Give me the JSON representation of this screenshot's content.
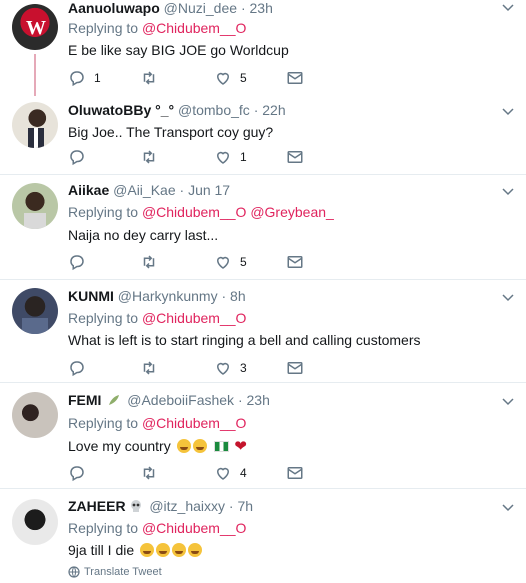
{
  "tweets": [
    {
      "name": "Aanuoluwapo",
      "handle": "@Nuzi_dee",
      "dot": "·",
      "time": "23h",
      "replying": "Replying to",
      "mention1": "@Chidubem__O",
      "mention2": "",
      "text": "E be like say BIG JOE go Worldcup",
      "replies": "1",
      "retweets": "",
      "likes": "5"
    },
    {
      "name": "OluwatoBBy °_°",
      "handle": "@tombo_fc",
      "dot": "·",
      "time": "22h",
      "text": "Big Joe.. The Transport coy guy?",
      "replies": "",
      "retweets": "",
      "likes": "1"
    },
    {
      "name": "Aiikae",
      "handle": "@Aii_Kae",
      "dot": "·",
      "time": "Jun 17",
      "replying": "Replying to",
      "mention1": "@Chidubem__O",
      "mention2": "@Greybean_",
      "text": "Naija no dey carry last...",
      "replies": "",
      "retweets": "",
      "likes": "5"
    },
    {
      "name": "KUNMI",
      "handle": "@Harkynkunmy",
      "dot": "·",
      "time": "8h",
      "replying": "Replying to",
      "mention1": "@Chidubem__O",
      "text": "What is left is to start ringing a bell and calling customers",
      "replies": "",
      "retweets": "",
      "likes": "3"
    },
    {
      "name": "FEMI",
      "handle": "@AdeboiiFashek",
      "dot": "·",
      "time": "23h",
      "replying": "Replying to",
      "mention1": "@Chidubem__O",
      "text": "Love my country",
      "replies": "",
      "retweets": "",
      "likes": "4"
    },
    {
      "name": "ZAHEER",
      "handle": "@itz_haixxy",
      "dot": "·",
      "time": "7h",
      "replying": "Replying to",
      "mention1": "@Chidubem__O",
      "text": "9ja till I die"
    }
  ],
  "translate_label": "Translate Tweet",
  "colors": {
    "mention": "#e0245e",
    "meta": "#657786",
    "thread_line": "#e5a9b8"
  }
}
